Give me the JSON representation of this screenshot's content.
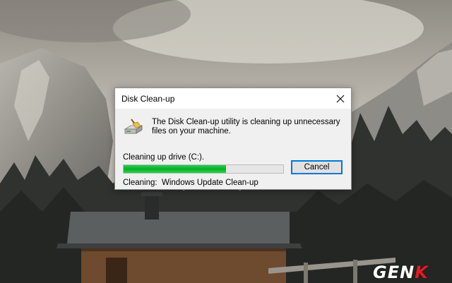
{
  "dialog": {
    "title": "Disk Clean-up",
    "message": "The Disk Clean-up utility is cleaning up unnecessary files on your machine.",
    "drive_label": "Cleaning up drive  (C:).",
    "progress_fraction": 0.64,
    "cancel_label": "Cancel",
    "status_label": "Cleaning:",
    "status_value": "Windows Update Clean-up",
    "icons": [
      "disk-cleanup-icon",
      "close-icon"
    ]
  },
  "watermark": {
    "text_main": "GEN",
    "text_accent": "K"
  },
  "colors": {
    "progress": "#06b025",
    "focus_border": "#0078d7",
    "watermark_accent": "#e31b23"
  }
}
